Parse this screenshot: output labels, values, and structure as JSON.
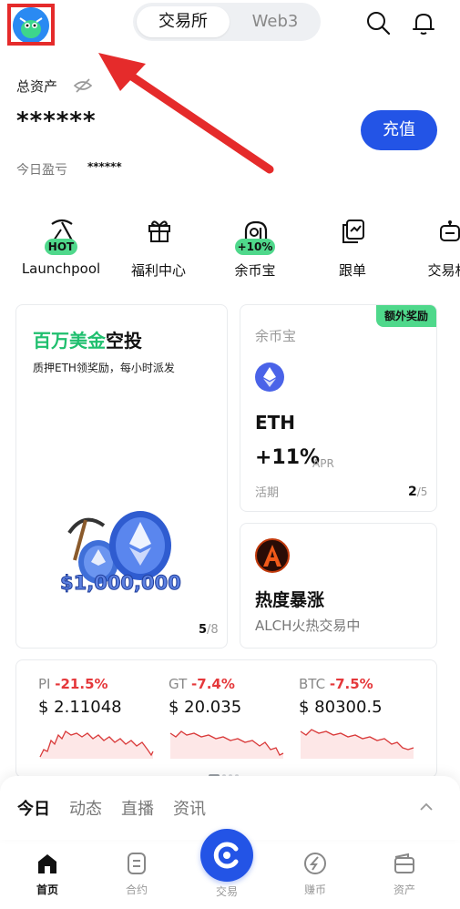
{
  "header": {
    "tabs": [
      {
        "label": "交易所"
      },
      {
        "label": "Web3"
      }
    ],
    "active_tab": "交易所",
    "icons": [
      "avatar",
      "search-icon",
      "bell-icon"
    ]
  },
  "assets": {
    "total_label": "总资产",
    "balance": "******",
    "pnl_label": "今日盈亏",
    "pnl_value": "******",
    "deposit_label": "充值"
  },
  "shortcuts": [
    {
      "label": "Launchpool",
      "badge": "HOT",
      "icon": "pickaxe-icon"
    },
    {
      "label": "福利中心",
      "badge": "",
      "icon": "gift-icon"
    },
    {
      "label": "余币宝",
      "badge": "+10%",
      "icon": "coin-stack-icon"
    },
    {
      "label": "跟单",
      "badge": "",
      "icon": "copy-trade-icon"
    },
    {
      "label": "交易机",
      "badge": "",
      "icon": "robot-icon"
    }
  ],
  "promo": {
    "title_green": "百万美金",
    "title_black": "空投",
    "subtitle": "质押ETH领奖励，每小时派发",
    "amount": "$1,000,000",
    "page_current": "5",
    "page_total": "/8"
  },
  "earn_card": {
    "bonus_badge": "额外奖励",
    "title": "余币宝",
    "symbol": "ETH",
    "apr": "+11%",
    "apr_unit": "APR",
    "term": "活期",
    "page_current": "2",
    "page_total": "/5"
  },
  "hot_card": {
    "title": "热度暴涨",
    "subtitle": "ALCH火热交易中"
  },
  "tickers": [
    {
      "symbol": "PI",
      "change": "-21.5%",
      "price": "$ 2.11048"
    },
    {
      "symbol": "GT",
      "change": "-7.4%",
      "price": "$ 20.035"
    },
    {
      "symbol": "BTC",
      "change": "-7.5%",
      "price": "$ 80300.5"
    }
  ],
  "feed_tabs": [
    "今日",
    "动态",
    "直播",
    "资讯"
  ],
  "bottom_nav": [
    {
      "label": "首页",
      "icon": "home-icon",
      "active": true
    },
    {
      "label": "合约",
      "icon": "contract-icon",
      "active": false
    },
    {
      "label": "交易",
      "icon": "trade-icon",
      "active": false
    },
    {
      "label": "赚币",
      "icon": "earn-icon",
      "active": false
    },
    {
      "label": "资产",
      "icon": "wallet-icon",
      "active": false
    }
  ],
  "colors": {
    "brand_blue": "#2354e6",
    "accent_green": "#4fd88b",
    "loss_red": "#e5383b",
    "annotation_red": "#e52b2b"
  }
}
